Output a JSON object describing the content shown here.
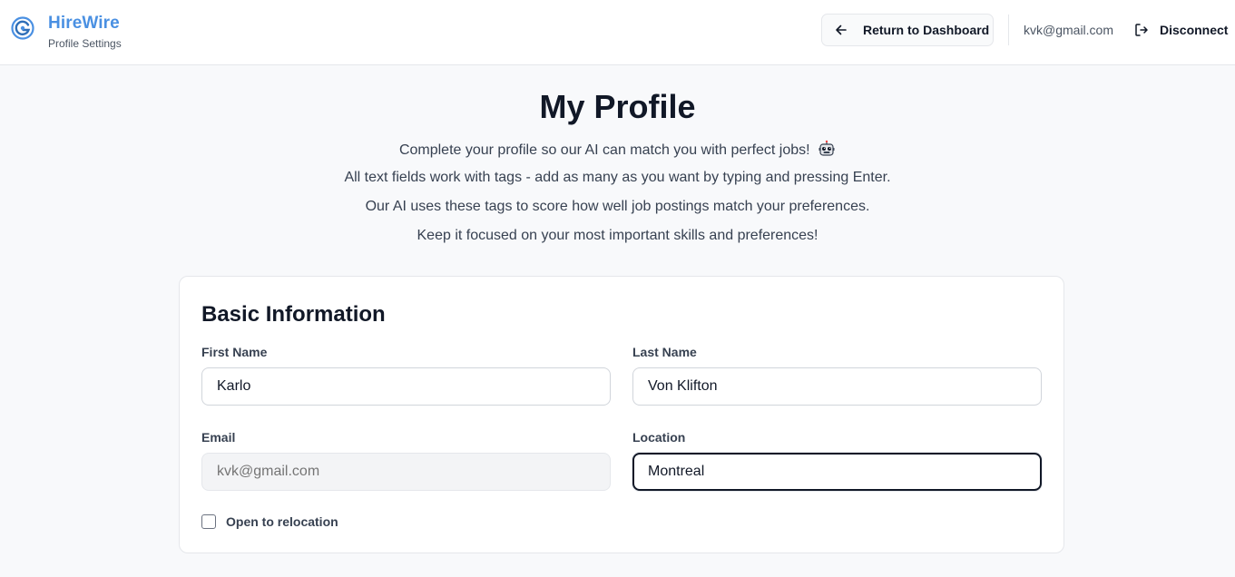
{
  "header": {
    "brand_name": "HireWire",
    "brand_subtitle": "Profile Settings",
    "return_label": "Return to Dashboard",
    "user_email": "kvk@gmail.com",
    "disconnect_label": "Disconnect",
    "accent_color": "#4a90e2"
  },
  "intro": {
    "title": "My Profile",
    "line1": "Complete your profile so our AI can match you with perfect jobs!",
    "line2": "All text fields work with tags - add as many as you want by typing and pressing Enter.",
    "line3": "Our AI uses these tags to score how well job postings match your preferences.",
    "line4": "Keep it focused on your most important skills and preferences!"
  },
  "basic_info": {
    "title": "Basic Information",
    "first_name_label": "First Name",
    "first_name_value": "Karlo",
    "last_name_label": "Last Name",
    "last_name_value": "Von Klifton",
    "email_label": "Email",
    "email_placeholder": "kvk@gmail.com",
    "location_label": "Location",
    "location_value": "Montreal",
    "relocation_label": "Open to relocation",
    "relocation_checked": false
  }
}
